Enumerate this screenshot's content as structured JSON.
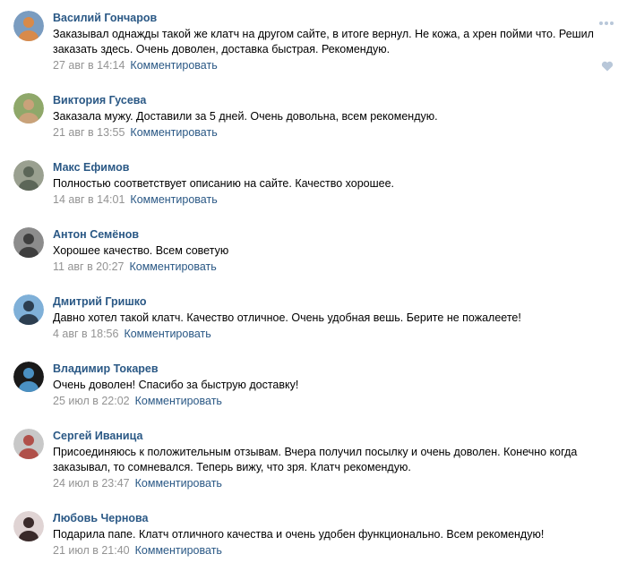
{
  "comments": [
    {
      "author": "Василий Гончаров",
      "text": "Заказывал однажды такой же клатч на другом сайте, в итоге вернул. Не кожа, а хрен пойми что. Решил заказать здесь. Очень доволен, доставка быстрая. Рекомендую.",
      "date": "27 авг в 14:14",
      "reply": "Комментировать",
      "lines": 2,
      "avatar_colors": [
        "#7a9cc0",
        "#d88a4a"
      ],
      "hover_actions": true
    },
    {
      "author": "Виктория Гусева",
      "text": "Заказала мужу. Доставили за 5 дней. Очень довольна, всем рекомендую.",
      "date": "21 авг в 13:55",
      "reply": "Комментировать",
      "lines": 1,
      "avatar_colors": [
        "#8fa86a",
        "#c9a27a"
      ]
    },
    {
      "author": "Макс Ефимов",
      "text": "Полностью соответствует описанию на сайте. Качество хорошее.",
      "date": "14 авг в 14:01",
      "reply": "Комментировать",
      "lines": 1,
      "avatar_colors": [
        "#9aa090",
        "#5c6658"
      ]
    },
    {
      "author": "Антон Семёнов",
      "text": "Хорошее качество. Всем советую",
      "date": "11 авг в 20:27",
      "reply": "Комментировать",
      "lines": 1,
      "avatar_colors": [
        "#8c8c8c",
        "#3e3e3e"
      ]
    },
    {
      "author": "Дмитрий Гришко",
      "text": "Давно хотел такой клатч. Качество отличное. Очень удобная вешь. Берите не пожалеете!",
      "date": "4 авг в 18:56",
      "reply": "Комментировать",
      "lines": 1,
      "avatar_colors": [
        "#7fb0d8",
        "#2c3e50"
      ]
    },
    {
      "author": "Владимир Токарев",
      "text": "Очень доволен! Спасибо за быструю доставку!",
      "date": "25 июл в 22:02",
      "reply": "Комментировать",
      "lines": 1,
      "avatar_colors": [
        "#1a1a1a",
        "#4a90c2"
      ]
    },
    {
      "author": "Сергей Иваница",
      "text": "Присоединяюсь к положительным отзывам. Вчера получил посылку и очень доволен. Конечно когда заказывал, то сомневался. Теперь вижу, что зря. Клатч рекомендую.",
      "date": "24 июл в 23:47",
      "reply": "Комментировать",
      "lines": 2,
      "avatar_colors": [
        "#c8c8c8",
        "#b0504a"
      ]
    },
    {
      "author": "Любовь Чернова",
      "text": "Подарила папе. Клатч отличного качества и очень удобен функционально. Всем рекомендую!",
      "date": "21 июл в 21:40",
      "reply": "Комментировать",
      "lines": 1,
      "avatar_colors": [
        "#e0d4d4",
        "#3a2a2a"
      ]
    }
  ],
  "colors": {
    "author": "#2a5885",
    "link": "#2a5885",
    "date": "#939393",
    "text": "#000000",
    "icon": "#b8c7d9"
  },
  "icons": {
    "more": "more-icon",
    "like": "heart-icon"
  }
}
